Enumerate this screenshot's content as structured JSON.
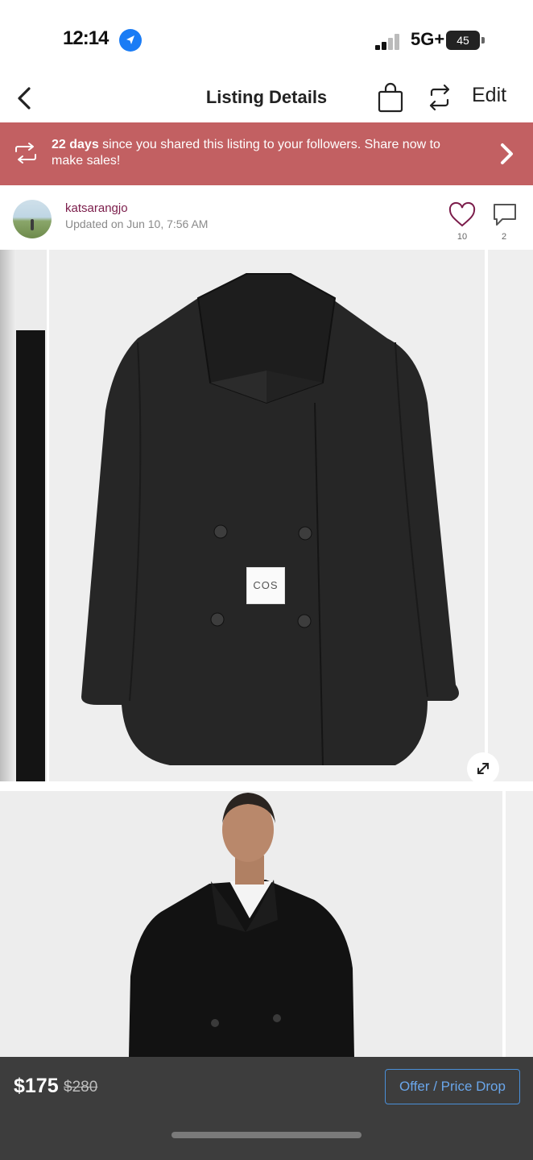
{
  "status_bar": {
    "time": "12:14",
    "network": "5G+",
    "battery": "45"
  },
  "nav": {
    "title": "Listing Details",
    "edit_label": "Edit"
  },
  "banner": {
    "highlight": "22 days",
    "text": " since you shared this listing to your followers. Share now to make sales!",
    "bg_color": "#c26062"
  },
  "seller": {
    "username": "katsarangjo",
    "updated": "Updated on Jun 10, 7:56 AM",
    "likes": "10",
    "comments": "2"
  },
  "gallery": {
    "brand_tag": "COS"
  },
  "bottom_bar": {
    "price": "$175",
    "original_price": "$280",
    "offer_label": "Offer / Price Drop",
    "accent_color": "#4a8fd8"
  },
  "icons": [
    "location-arrow-icon",
    "signal-icon",
    "battery-icon",
    "back-chevron-icon",
    "shopping-bag-icon",
    "share-arrows-icon",
    "repost-icon",
    "chevron-right-icon",
    "heart-icon",
    "comment-icon",
    "expand-icon"
  ]
}
